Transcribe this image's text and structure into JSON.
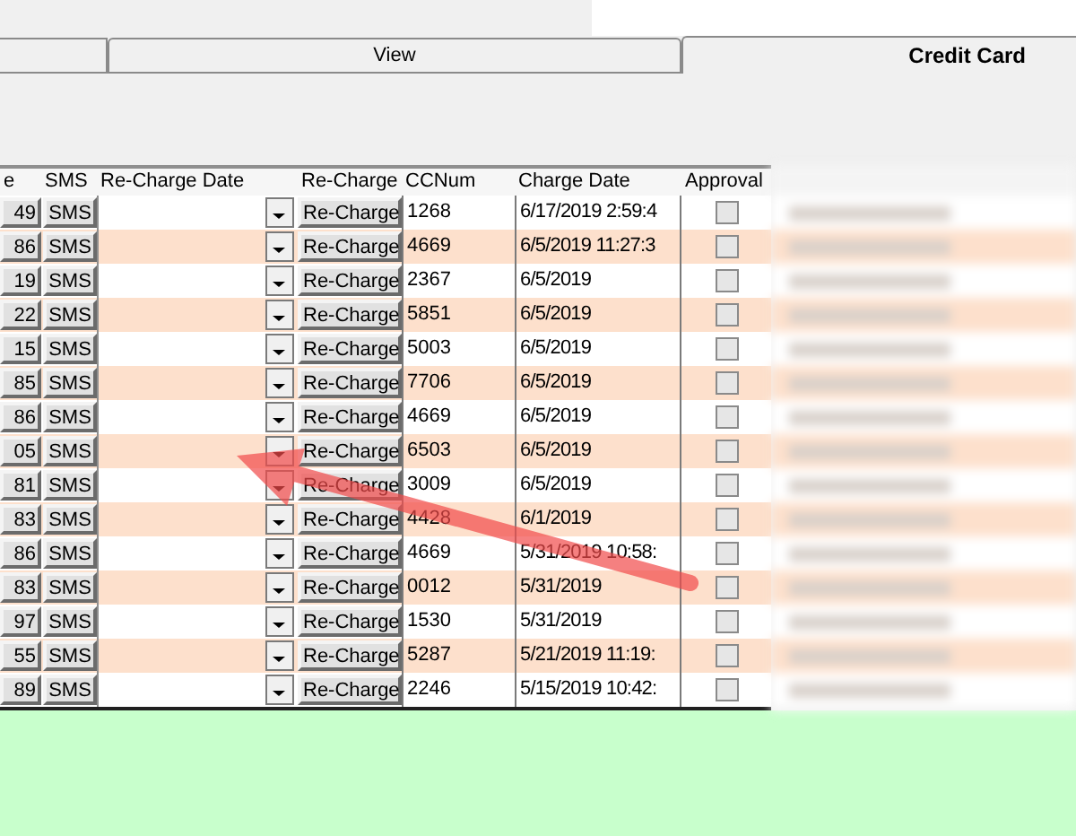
{
  "tabs": [
    {
      "label": "View",
      "selected": false
    },
    {
      "label": "Credit Card",
      "selected": true
    }
  ],
  "grid": {
    "columns": [
      "e",
      "SMS",
      "Re-Charge Date",
      "Re-Charge",
      "CCNum",
      "Charge Date",
      "Approval"
    ],
    "rows": [
      {
        "id": "49",
        "sms": "SMS",
        "recharge": "Re-Charge",
        "ccnum": "1268",
        "charge_date": "6/17/2019 2:59:4",
        "approved": false
      },
      {
        "id": "86",
        "sms": "SMS",
        "recharge": "Re-Charge",
        "ccnum": "4669",
        "charge_date": "6/5/2019 11:27:3",
        "approved": false
      },
      {
        "id": "19",
        "sms": "SMS",
        "recharge": "Re-Charge",
        "ccnum": "2367",
        "charge_date": "6/5/2019",
        "approved": false
      },
      {
        "id": "22",
        "sms": "SMS",
        "recharge": "Re-Charge",
        "ccnum": "5851",
        "charge_date": "6/5/2019",
        "approved": false
      },
      {
        "id": "15",
        "sms": "SMS",
        "recharge": "Re-Charge",
        "ccnum": "5003",
        "charge_date": "6/5/2019",
        "approved": false
      },
      {
        "id": "85",
        "sms": "SMS",
        "recharge": "Re-Charge",
        "ccnum": "7706",
        "charge_date": "6/5/2019",
        "approved": false
      },
      {
        "id": "86",
        "sms": "SMS",
        "recharge": "Re-Charge",
        "ccnum": "4669",
        "charge_date": "6/5/2019",
        "approved": false
      },
      {
        "id": "05",
        "sms": "SMS",
        "recharge": "Re-Charge",
        "ccnum": "6503",
        "charge_date": "6/5/2019",
        "approved": false
      },
      {
        "id": "81",
        "sms": "SMS",
        "recharge": "Re-Charge",
        "ccnum": "3009",
        "charge_date": "6/5/2019",
        "approved": false
      },
      {
        "id": "83",
        "sms": "SMS",
        "recharge": "Re-Charge",
        "ccnum": "4428",
        "charge_date": "6/1/2019",
        "approved": false
      },
      {
        "id": "86",
        "sms": "SMS",
        "recharge": "Re-Charge",
        "ccnum": "4669",
        "charge_date": "5/31/2019 10:58:",
        "approved": false
      },
      {
        "id": "83",
        "sms": "SMS",
        "recharge": "Re-Charge",
        "ccnum": "0012",
        "charge_date": "5/31/2019",
        "approved": false
      },
      {
        "id": "97",
        "sms": "SMS",
        "recharge": "Re-Charge",
        "ccnum": "1530",
        "charge_date": "5/31/2019",
        "approved": false
      },
      {
        "id": "55",
        "sms": "SMS",
        "recharge": "Re-Charge",
        "ccnum": "5287",
        "charge_date": "5/21/2019 11:19:",
        "approved": false
      },
      {
        "id": "89",
        "sms": "SMS",
        "recharge": "Re-Charge",
        "ccnum": "2246",
        "charge_date": "5/15/2019 10:42:",
        "approved": false
      }
    ]
  }
}
